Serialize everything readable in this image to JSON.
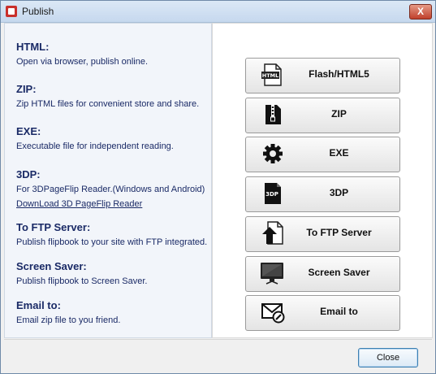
{
  "window": {
    "title": "Publish",
    "close_glyph": "X"
  },
  "info": [
    {
      "heading": "HTML:",
      "desc": "Open via browser, publish online."
    },
    {
      "heading": "ZIP:",
      "desc": "Zip HTML files for convenient store and share."
    },
    {
      "heading": "EXE:",
      "desc": "Executable file for independent reading."
    },
    {
      "heading": "3DP:",
      "desc": "For 3DPageFlip Reader.(Windows and Android)",
      "link": "DownLoad 3D PageFlip Reader"
    },
    {
      "heading": "To FTP Server:",
      "desc": "Publish flipbook to your site with FTP integrated."
    },
    {
      "heading": "Screen Saver:",
      "desc": "Publish flipbook to Screen Saver."
    },
    {
      "heading": "Email to:",
      "desc": "Email zip file to you friend."
    }
  ],
  "buttons": [
    {
      "label": "Flash/HTML5",
      "icon": "html-file-icon",
      "icon_text": "HTML"
    },
    {
      "label": "ZIP",
      "icon": "zip-file-icon"
    },
    {
      "label": "EXE",
      "icon": "gear-icon"
    },
    {
      "label": "3DP",
      "icon": "3dp-file-icon",
      "icon_text": "3DP"
    },
    {
      "label": "To FTP Server",
      "icon": "upload-arrow-icon"
    },
    {
      "label": "Screen Saver",
      "icon": "monitor-icon"
    },
    {
      "label": "Email to",
      "icon": "email-icon"
    }
  ],
  "footer": {
    "close_label": "Close"
  },
  "colors": {
    "heading": "#1a2a66",
    "panel": "#f2f5fa",
    "accent": "#3c7fb1"
  }
}
